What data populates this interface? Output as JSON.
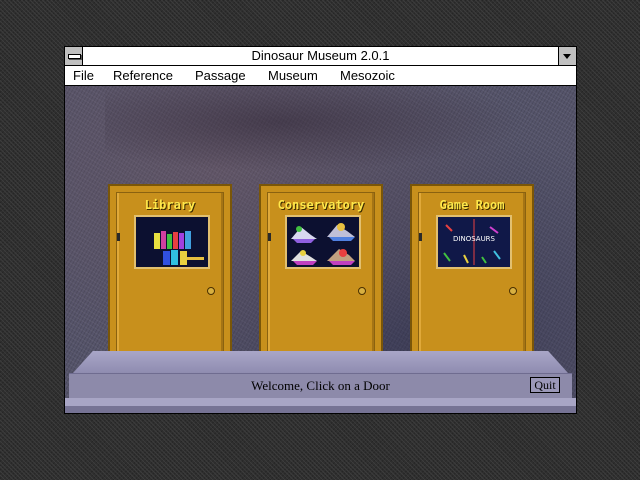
{
  "window": {
    "title": "Dinosaur Museum 2.0.1"
  },
  "menubar": {
    "items": [
      "File",
      "Reference",
      "Passage",
      "Museum",
      "Mesozoic"
    ]
  },
  "doors": [
    {
      "label": "Library"
    },
    {
      "label": "Conservatory"
    },
    {
      "label": "Game Room",
      "window_text": "DINOSAURS"
    }
  ],
  "status": {
    "text": "Welcome, Click on a Door",
    "quit_label": "Quit"
  },
  "colors": {
    "door": "#c8901c",
    "door_label": "#ffe84a",
    "stage": "#8d8aaa"
  }
}
